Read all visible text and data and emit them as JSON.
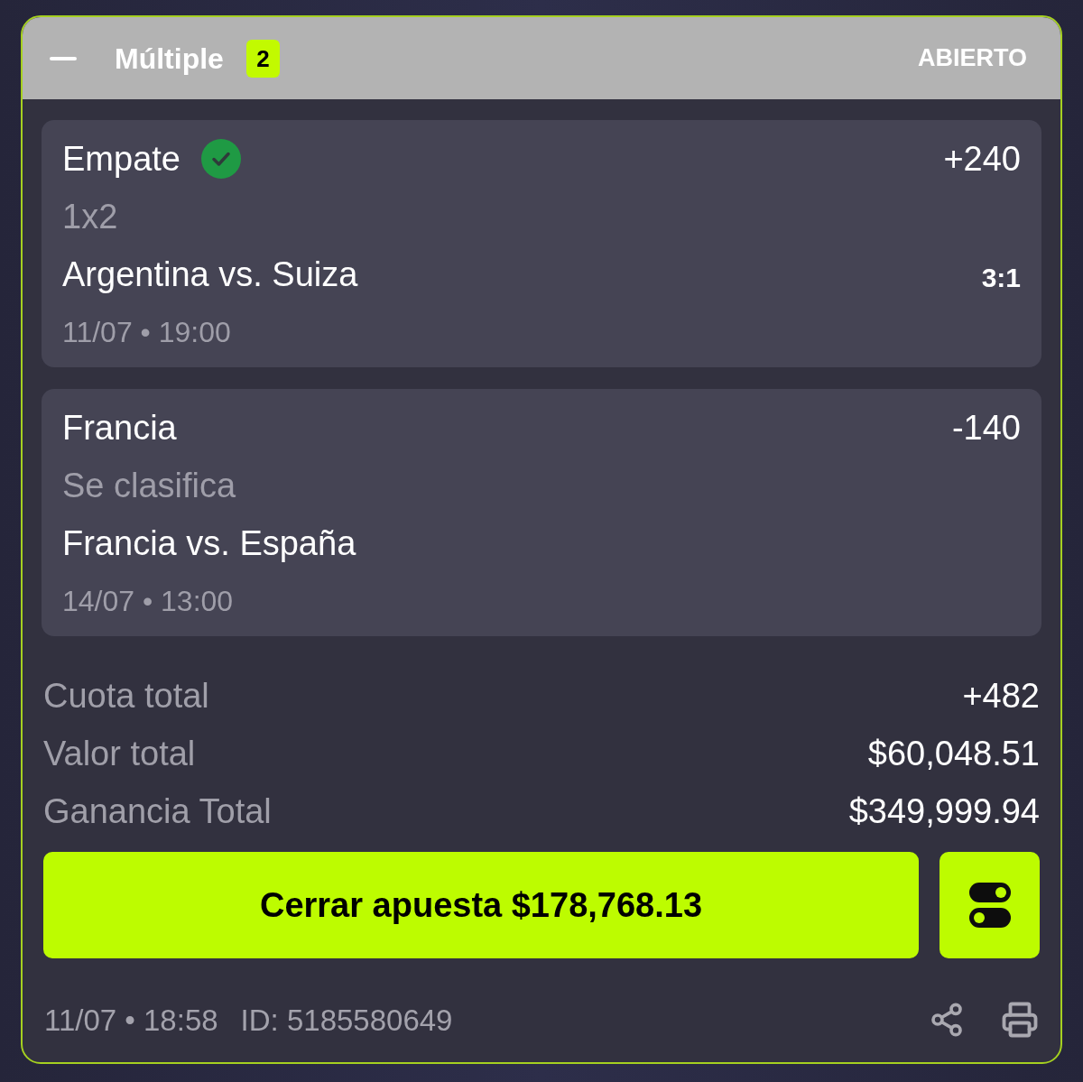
{
  "bet": {
    "expanded": true,
    "title": "Múltiple",
    "count": "2",
    "status": "ABIERTO"
  },
  "selections": [
    {
      "pick": "Empate",
      "won": true,
      "odds": "+240",
      "market": "1x2",
      "match": "Argentina vs. Suiza",
      "score": "3:1",
      "datetime": "11/07 • 19:00"
    },
    {
      "pick": "Francia",
      "won": false,
      "odds": "-140",
      "market": "Se clasifica",
      "match": "Francia vs. España",
      "datetime": "14/07 • 13:00"
    }
  ],
  "summary": [
    {
      "label": "Cuota total",
      "value": "+482"
    },
    {
      "label": "Valor total",
      "value": "$60,048.51"
    },
    {
      "label": "Ganancia Total",
      "value": "$349,999.94"
    }
  ],
  "cash_out_button": "Cerrar apuesta $178,768.13",
  "footer": {
    "placed": "11/07 • 18:58",
    "id": "ID: 5185580649"
  }
}
